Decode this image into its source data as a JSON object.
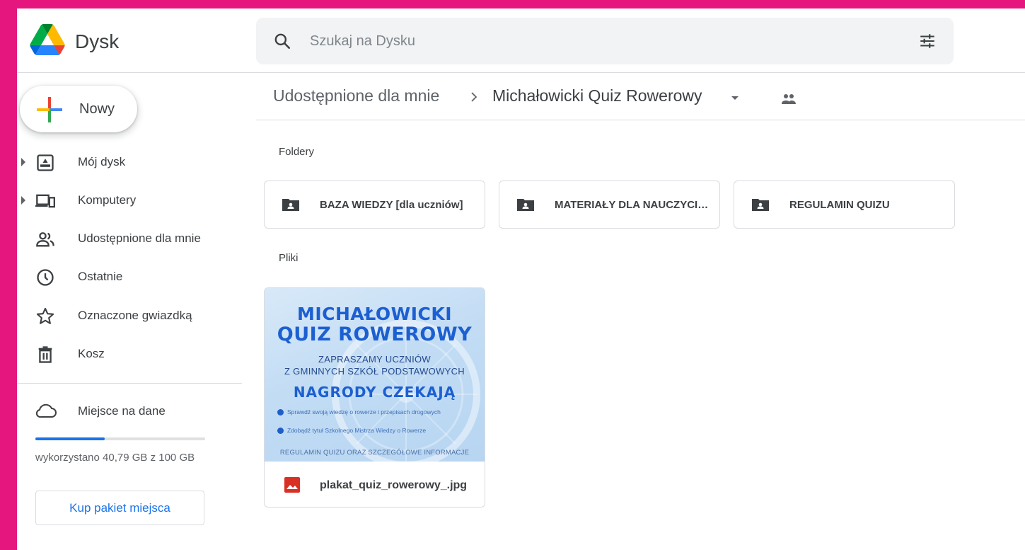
{
  "app": {
    "name": "Dysk",
    "brand_colors": [
      "#1a73e8",
      "#34a853",
      "#fbbc04",
      "#ea4335"
    ]
  },
  "search": {
    "placeholder": "Szukaj na Dysku"
  },
  "sidebar": {
    "new_label": "Nowy",
    "items": [
      {
        "label": "Mój dysk",
        "icon": "my-drive-icon",
        "expandable": true
      },
      {
        "label": "Komputery",
        "icon": "computers-icon",
        "expandable": true
      },
      {
        "label": "Udostępnione dla mnie",
        "icon": "shared-with-me-icon",
        "expandable": false
      },
      {
        "label": "Ostatnie",
        "icon": "clock-icon",
        "expandable": false
      },
      {
        "label": "Oznaczone gwiazdką",
        "icon": "star-icon",
        "expandable": false
      },
      {
        "label": "Kosz",
        "icon": "trash-icon",
        "expandable": false
      }
    ],
    "storage": {
      "label": "Miejsce na dane",
      "used_fraction": 0.4079,
      "text": "wykorzystano 40,79 GB z 100 GB",
      "buy_label": "Kup pakiet miejsca"
    }
  },
  "breadcrumb": {
    "parent": "Udostępnione dla mnie",
    "current": "Michałowicki Quiz Rowerowy"
  },
  "sections": {
    "folders_title": "Foldery",
    "files_title": "Pliki"
  },
  "folders": [
    {
      "name": "BAZA WIEDZY [dla uczniów]"
    },
    {
      "name": "MATERIAŁY DLA NAUCZYCIELI"
    },
    {
      "name": "REGULAMIN QUIZU"
    }
  ],
  "files": [
    {
      "name": "plakat_quiz_rowerowy_.jpg",
      "icon": "image-file-icon",
      "thumbnail": {
        "title_line1": "MICHAŁOWICKI",
        "title_line2": "QUIZ ROWEROWY",
        "sub_line1": "ZAPRASZAMY UCZNIÓW",
        "sub_line2": "Z GMINNYCH  SZKÓŁ PODSTAWOWYCH",
        "headline": "NAGRODY CZEKAJĄ",
        "bullet1": "Sprawdź swoją wiedzę o rowerze i przepisach drogowych",
        "bullet2": "Zdobądź tytuł Szkolnego Mistrza Wiedzy o Rowerze",
        "footer": "REGULAMIN QUIZU ORAZ SZCZEGÓŁOWE INFORMACJE"
      }
    }
  ]
}
